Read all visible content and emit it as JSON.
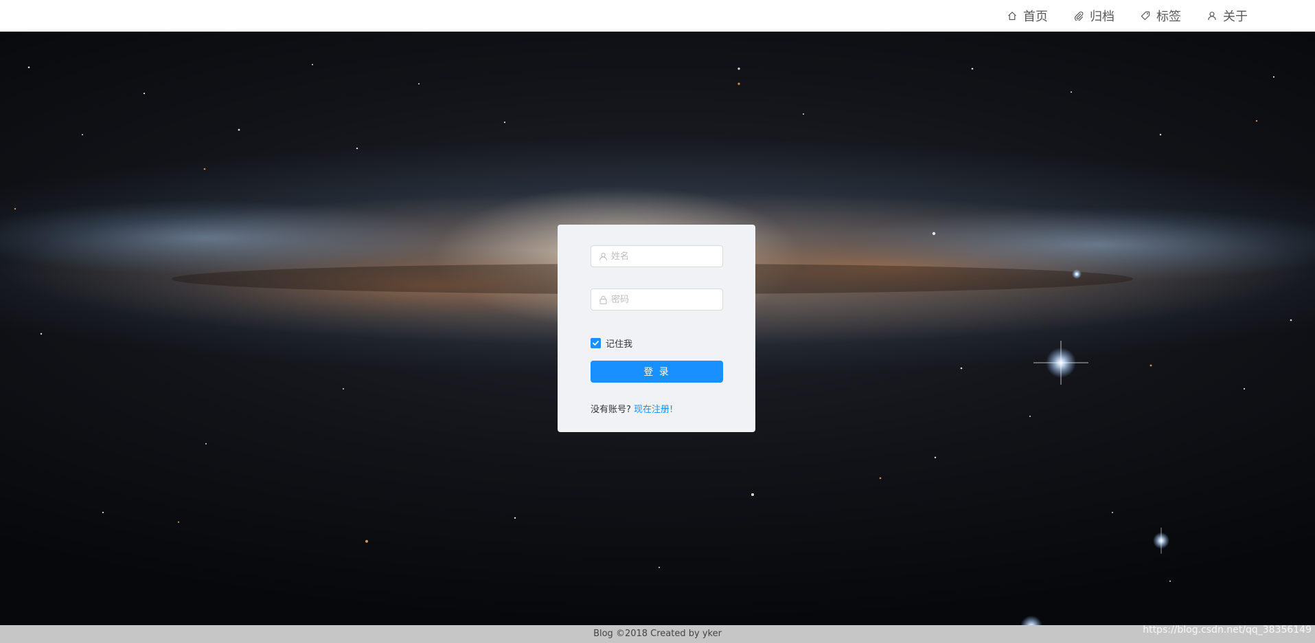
{
  "nav": {
    "items": [
      {
        "label": "首页",
        "icon": "home-icon"
      },
      {
        "label": "归档",
        "icon": "paperclip-icon"
      },
      {
        "label": "标签",
        "icon": "tag-icon"
      },
      {
        "label": "关于",
        "icon": "user-icon"
      }
    ]
  },
  "login": {
    "username_placeholder": "姓名",
    "username_value": "",
    "password_placeholder": "密码",
    "password_value": "",
    "remember_label": "记住我",
    "remember_checked": true,
    "submit_label": "登 录",
    "register_prompt": "没有账号?",
    "register_link": "现在注册!"
  },
  "footer": {
    "text": "Blog ©2018 Created by yker"
  },
  "watermark": {
    "text": "https://blog.csdn.net/qq_38356149"
  },
  "colors": {
    "accent": "#1890ff",
    "card_bg": "#f0f2f5",
    "topbar_bg": "#ffffff",
    "footer_bg": "#c6c6c6"
  }
}
